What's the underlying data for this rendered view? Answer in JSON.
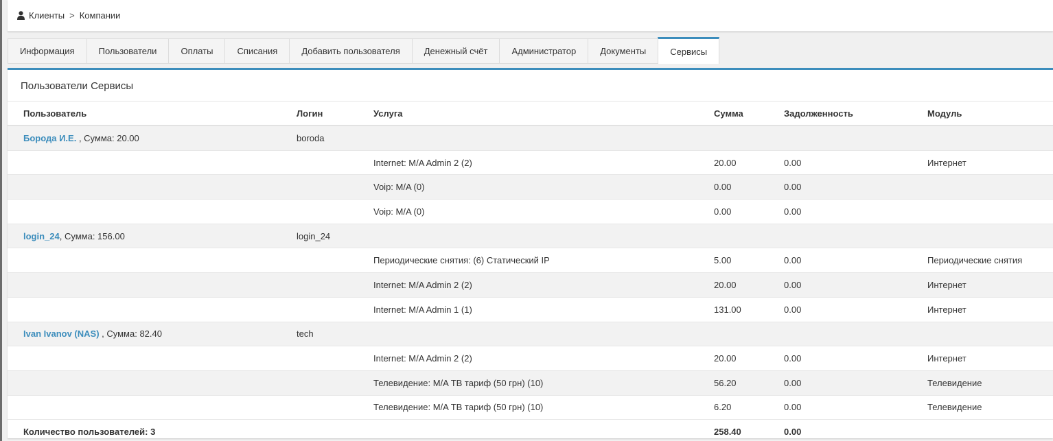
{
  "breadcrumb": {
    "items": [
      "Клиенты",
      "Компании"
    ],
    "separator": ">"
  },
  "tabs": [
    {
      "label": "Информация",
      "active": false
    },
    {
      "label": "Пользователи",
      "active": false
    },
    {
      "label": "Оплаты",
      "active": false
    },
    {
      "label": "Списания",
      "active": false
    },
    {
      "label": "Добавить пользователя",
      "active": false
    },
    {
      "label": "Денежный счёт",
      "active": false
    },
    {
      "label": "Администратор",
      "active": false
    },
    {
      "label": "Документы",
      "active": false
    },
    {
      "label": "Сервисы",
      "active": true
    }
  ],
  "panel": {
    "title": "Пользователи Сервисы"
  },
  "table": {
    "columns": [
      "Пользователь",
      "Логин",
      "Услуга",
      "Сумма",
      "Задолженность",
      "Модуль"
    ],
    "rows": [
      {
        "type": "user",
        "name": "Борода И.Е.",
        "sum_text": " , Сумма: 20.00",
        "login": "boroda"
      },
      {
        "type": "service",
        "service": "Internet: M/A Admin 2 (2)",
        "sum": "20.00",
        "debt": "0.00",
        "module": "Интернет"
      },
      {
        "type": "service",
        "service": "Voip: M/A (0)",
        "sum": "0.00",
        "debt": "0.00",
        "module": ""
      },
      {
        "type": "service",
        "service": "Voip: M/A (0)",
        "sum": "0.00",
        "debt": "0.00",
        "module": ""
      },
      {
        "type": "user",
        "name": "login_24",
        "sum_text": ", Сумма: 156.00",
        "login": "login_24"
      },
      {
        "type": "service",
        "service": "Периодические снятия: (6) Статический IP",
        "sum": "5.00",
        "debt": "0.00",
        "module": "Периодические снятия"
      },
      {
        "type": "service",
        "service": "Internet: M/A Admin 2 (2)",
        "sum": "20.00",
        "debt": "0.00",
        "module": "Интернет"
      },
      {
        "type": "service",
        "service": "Internet: M/A Admin 1 (1)",
        "sum": "131.00",
        "debt": "0.00",
        "module": "Интернет"
      },
      {
        "type": "user",
        "name": "Ivan Ivanov (NAS)",
        "sum_text": " , Сумма: 82.40",
        "login": "tech"
      },
      {
        "type": "service",
        "service": "Internet: M/A Admin 2 (2)",
        "sum": "20.00",
        "debt": "0.00",
        "module": "Интернет"
      },
      {
        "type": "service",
        "service": "Телевидение: M/A ТВ тариф (50 грн) (10)",
        "sum": "56.20",
        "debt": "0.00",
        "module": "Телевидение"
      },
      {
        "type": "service",
        "service": "Телевидение: M/A ТВ тариф (50 грн) (10)",
        "sum": "6.20",
        "debt": "0.00",
        "module": "Телевидение"
      }
    ],
    "total": {
      "label": "Количество пользователей: 3",
      "sum": "258.40",
      "debt": "0.00"
    }
  },
  "colors": {
    "accent": "#3c8dbc",
    "stripe": "#f2f2f2"
  }
}
